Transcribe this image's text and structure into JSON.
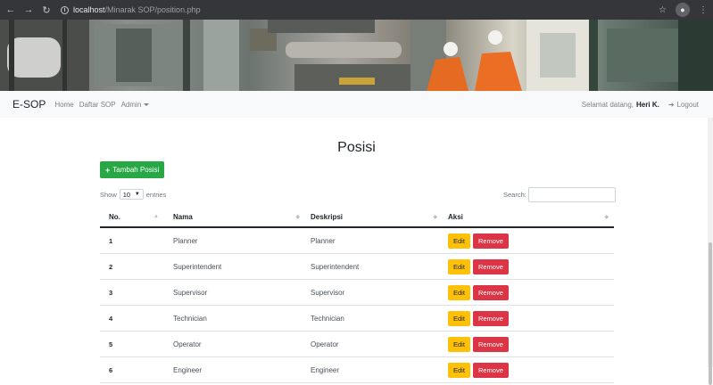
{
  "browser": {
    "url_host": "localhost",
    "url_path": "/Minarak SOP/position.php"
  },
  "navbar": {
    "brand": "E-SOP",
    "links": [
      "Home",
      "Daftar SOP",
      "Admin"
    ],
    "greeting": "Selamat datang,",
    "user": "Heri K.",
    "logout": "Logout"
  },
  "page": {
    "title": "Posisi",
    "add_button": "Tambah Posisi",
    "show_label": "Show",
    "entries_value": "10",
    "entries_label": "entries",
    "search_label": "Search:"
  },
  "table": {
    "headers": [
      "No.",
      "Nama",
      "Deskripsi",
      "Aksi"
    ],
    "edit_label": "Edit",
    "remove_label": "Remove",
    "rows": [
      {
        "no": "1",
        "nama": "Planner",
        "deskripsi": "Planner"
      },
      {
        "no": "2",
        "nama": "Superintendent",
        "deskripsi": "Superintendent"
      },
      {
        "no": "3",
        "nama": "Supervisor",
        "deskripsi": "Supervisor"
      },
      {
        "no": "4",
        "nama": "Technician",
        "deskripsi": "Technician"
      },
      {
        "no": "5",
        "nama": "Operator",
        "deskripsi": "Operator"
      },
      {
        "no": "6",
        "nama": "Engineer",
        "deskripsi": "Engineer"
      }
    ]
  },
  "colors": {
    "success": "#28a745",
    "warning": "#ffc107",
    "danger": "#dc3545"
  }
}
